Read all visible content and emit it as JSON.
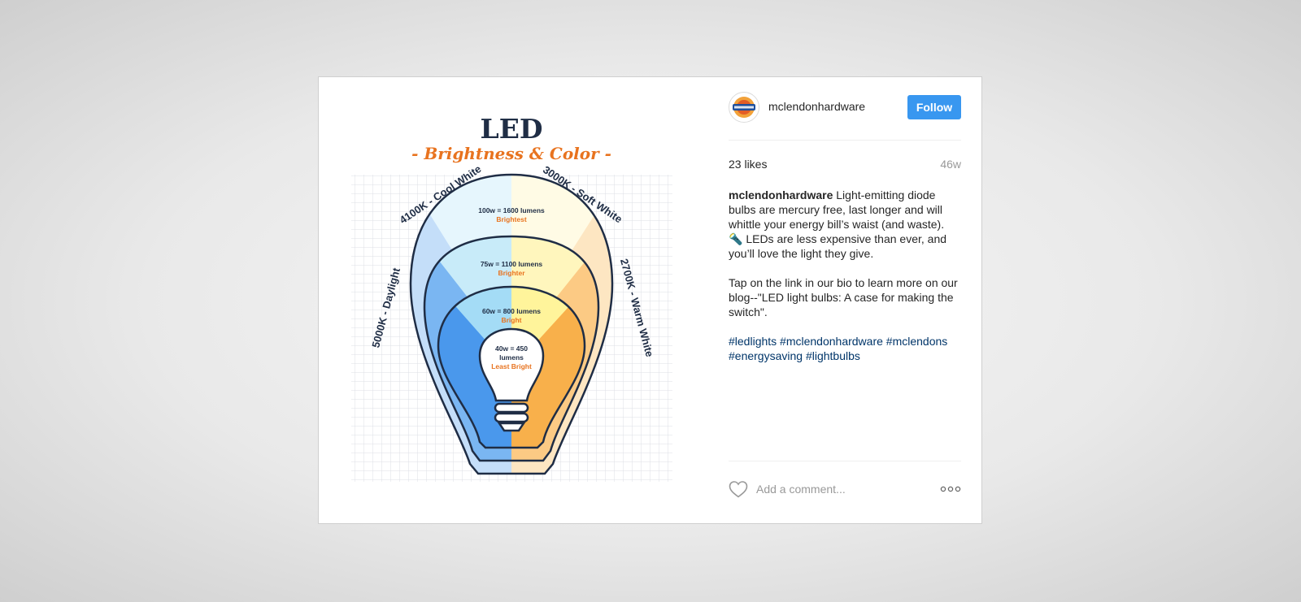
{
  "post": {
    "username": "mclendonhardware",
    "follow_label": "Follow",
    "likes": "23 likes",
    "age": "46w",
    "caption": {
      "author": "mclendonhardware",
      "text1": " Light-emitting diode bulbs are mercury free, last longer and will whittle your energy bill’s waist (and waste). ",
      "emoji": "🔦",
      "text2": " LEDs are less expensive than ever, and you’ll love the light they give.",
      "paragraph2": "Tap on the link in our bio to learn more on our blog--\"LED light bulbs: A case for making the switch\".",
      "hashtags": [
        "#ledlights",
        "#mclendonhardware",
        "#mclendons",
        "#energysaving",
        "#lightbulbs"
      ]
    },
    "comment_placeholder": "Add a comment...",
    "more_icon": "more-options-icon",
    "heart_icon": "heart-icon"
  },
  "infographic": {
    "title": "LED",
    "subtitle": "- Brightness & Color -",
    "color_temps": {
      "cool": "4100K - Cool White",
      "soft": "3000K - Soft White",
      "daylight": "5000K - Daylight",
      "warm": "2700K - Warm White"
    },
    "levels": [
      {
        "watts": "100w = 1600 lumens",
        "label": "Brightest"
      },
      {
        "watts": "75w = 1100 lumens",
        "label": "Brighter"
      },
      {
        "watts": "60w = 800 lumens",
        "label": "Bright"
      },
      {
        "watts_line1": "40w = 450",
        "watts_line2": "lumens",
        "label": "Least Bright"
      }
    ]
  },
  "colors": {
    "accent_blue": "#3897f0",
    "title_navy": "#1f2d45",
    "subtitle_orange": "#e8731f",
    "hashtag": "#003569"
  }
}
